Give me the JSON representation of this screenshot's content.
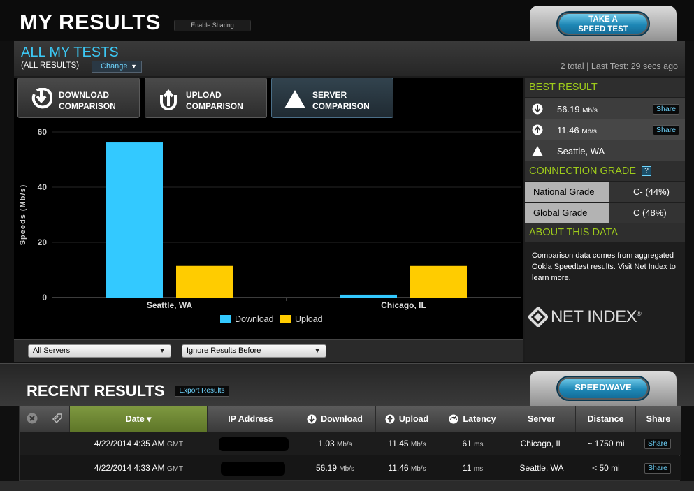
{
  "header": {
    "title": "MY RESULTS",
    "sharing_label": "Enable Sharing",
    "take_test_line1": "TAKE A",
    "take_test_line2": "SPEED TEST"
  },
  "tests": {
    "title": "ALL MY TESTS",
    "subtitle": "(ALL RESULTS)",
    "change_label": "Change",
    "meta": "2 total | Last Test: 29 secs ago",
    "compare_buttons": [
      {
        "line1": "DOWNLOAD",
        "line2": "COMPARISON",
        "icon": "download-arrow-icon"
      },
      {
        "line1": "UPLOAD",
        "line2": "COMPARISON",
        "icon": "upload-arrow-icon"
      },
      {
        "line1": "SERVER",
        "line2": "COMPARISON",
        "icon": "server-triangle-icon"
      }
    ],
    "filters": {
      "servers": "All Servers",
      "before": "Ignore Results Before"
    }
  },
  "chart_data": {
    "type": "bar",
    "categories": [
      "Seattle, WA",
      "Chicago, IL"
    ],
    "series": [
      {
        "name": "Download",
        "values": [
          56.19,
          1.03
        ],
        "color": "#33c9ff"
      },
      {
        "name": "Upload",
        "values": [
          11.46,
          11.45
        ],
        "color": "#ffcc00"
      }
    ],
    "ylabel": "Speeds (Mb/s)",
    "xlabel": "",
    "ylim": [
      0,
      60
    ],
    "yticks": [
      "0",
      "20",
      "40",
      "60"
    ],
    "grid": true,
    "legend": "bottom-center"
  },
  "sidebar": {
    "best_result_title": "BEST RESULT",
    "best_download": "56.19",
    "best_upload": "11.46",
    "unit": "Mb/s",
    "best_server": "Seattle, WA",
    "share_label": "Share",
    "grade_title": "CONNECTION GRADE",
    "grade_help": "?",
    "grades": [
      {
        "name": "National Grade",
        "value": "C- (44%)"
      },
      {
        "name": "Global Grade",
        "value": "C (48%)"
      }
    ],
    "about_title": "ABOUT THIS DATA",
    "about_text": "Comparison data comes from aggregated Ookla Speedtest results. Visit Net Index to learn more.",
    "brand": "NET INDEX",
    "brand_mark": "®"
  },
  "recent": {
    "title": "RECENT RESULTS",
    "export_label": "Export Results",
    "speedwave_label": "SPEEDWAVE",
    "columns": {
      "date": "Date ▾",
      "ip": "IP Address",
      "download": "Download",
      "upload": "Upload",
      "latency": "Latency",
      "server": "Server",
      "distance": "Distance",
      "share": "Share"
    },
    "rows": [
      {
        "date": "4/22/2014 4:35 AM",
        "tz": "GMT",
        "download": "1.03",
        "dl_unit": "Mb/s",
        "upload": "11.45",
        "ul_unit": "Mb/s",
        "latency": "61",
        "lat_unit": "ms",
        "server": "Chicago, IL",
        "distance": "~ 1750 mi",
        "share": "Share"
      },
      {
        "date": "4/22/2014 4:33 AM",
        "tz": "GMT",
        "download": "56.19",
        "dl_unit": "Mb/s",
        "upload": "11.46",
        "ul_unit": "Mb/s",
        "latency": "11",
        "lat_unit": "ms",
        "server": "Seattle, WA",
        "distance": "< 50 mi",
        "share": "Share"
      }
    ]
  },
  "colors": {
    "accent_blue": "#3cc8f4",
    "accent_green": "#9ecb1b",
    "download": "#33c9ff",
    "upload": "#ffcc00"
  }
}
